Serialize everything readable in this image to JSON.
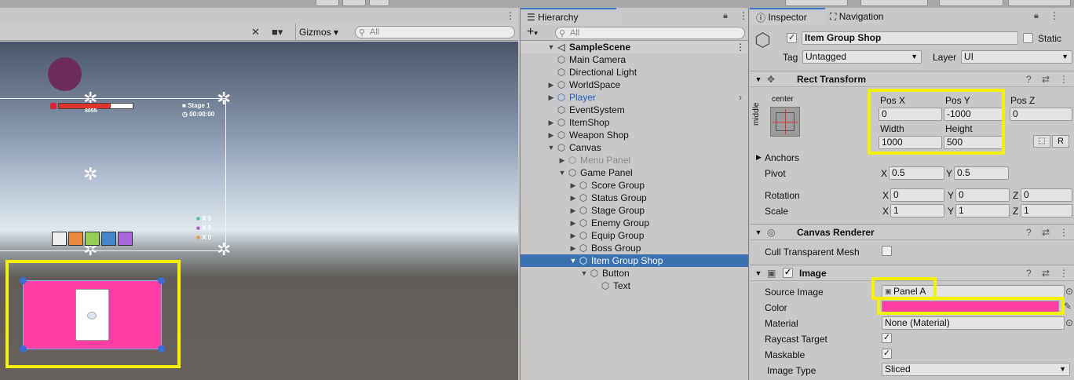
{
  "scene": {
    "toolbar": {
      "gizmos_label": "Gizmos",
      "search_placeholder": "All"
    },
    "hud": {
      "health_value": "8055",
      "stage_label": "Stage 1",
      "timer": "00:00:00",
      "counter_1": "X 0",
      "counter_2": "X 0",
      "counter_3": "X 0"
    }
  },
  "hierarchy": {
    "tab_label": "Hierarchy",
    "add_label": "+",
    "search_placeholder": "All",
    "scene_name": "SampleScene",
    "items": [
      {
        "label": "Main Camera",
        "depth": 1,
        "expand": "none"
      },
      {
        "label": "Directional Light",
        "depth": 1,
        "expand": "none"
      },
      {
        "label": "WorldSpace",
        "depth": 1,
        "expand": "collapsed"
      },
      {
        "label": "Player",
        "depth": 1,
        "expand": "collapsed",
        "prefab": true
      },
      {
        "label": "EventSystem",
        "depth": 1,
        "expand": "none"
      },
      {
        "label": "ItemShop",
        "depth": 1,
        "expand": "collapsed"
      },
      {
        "label": "Weapon Shop",
        "depth": 1,
        "expand": "collapsed"
      },
      {
        "label": "Canvas",
        "depth": 1,
        "expand": "expanded"
      },
      {
        "label": "Menu Panel",
        "depth": 2,
        "expand": "collapsed",
        "disabled": true
      },
      {
        "label": "Game Panel",
        "depth": 2,
        "expand": "expanded"
      },
      {
        "label": "Score Group",
        "depth": 3,
        "expand": "collapsed"
      },
      {
        "label": "Status Group",
        "depth": 3,
        "expand": "collapsed"
      },
      {
        "label": "Stage Group",
        "depth": 3,
        "expand": "collapsed"
      },
      {
        "label": "Enemy Group",
        "depth": 3,
        "expand": "collapsed"
      },
      {
        "label": "Equip Group",
        "depth": 3,
        "expand": "collapsed"
      },
      {
        "label": "Boss Group",
        "depth": 3,
        "expand": "collapsed"
      },
      {
        "label": "Item Group Shop",
        "depth": 3,
        "expand": "expanded",
        "selected": true
      },
      {
        "label": "Button",
        "depth": 4,
        "expand": "expanded"
      },
      {
        "label": "Text",
        "depth": 5,
        "expand": "none"
      }
    ]
  },
  "inspector": {
    "tab_inspector": "Inspector",
    "tab_navigation": "Navigation",
    "object_name": "Item Group Shop",
    "static_label": "Static",
    "tag_label": "Tag",
    "tag_value": "Untagged",
    "layer_label": "Layer",
    "layer_value": "UI",
    "rect_transform": {
      "title": "Rect Transform",
      "anchor_h": "center",
      "anchor_v": "middle",
      "pos_x_label": "Pos X",
      "pos_x": "0",
      "pos_y_label": "Pos Y",
      "pos_y": "-1000",
      "pos_z_label": "Pos Z",
      "pos_z": "0",
      "width_label": "Width",
      "width": "1000",
      "height_label": "Height",
      "height": "500",
      "r_button": "R",
      "anchors_label": "Anchors",
      "pivot_label": "Pivot",
      "pivot_x": "0.5",
      "pivot_y": "0.5",
      "rotation_label": "Rotation",
      "rot_x": "0",
      "rot_y": "0",
      "rot_z": "0",
      "scale_label": "Scale",
      "scale_x": "1",
      "scale_y": "1",
      "scale_z": "1",
      "axis_x": "X",
      "axis_y": "Y",
      "axis_z": "Z"
    },
    "canvas_renderer": {
      "title": "Canvas Renderer",
      "cull_label": "Cull Transparent Mesh"
    },
    "image": {
      "title": "Image",
      "source_label": "Source Image",
      "source_value": "Panel A",
      "color_label": "Color",
      "color_value": "#ff3ea5",
      "material_label": "Material",
      "material_value": "None (Material)",
      "raycast_label": "Raycast Target",
      "maskable_label": "Maskable",
      "type_label": "Image Type",
      "type_value": "Sliced"
    }
  },
  "colors": {
    "highlight": "#f5f100",
    "selection": "#3a72b0",
    "panel_pink": "#ff3ea5"
  }
}
